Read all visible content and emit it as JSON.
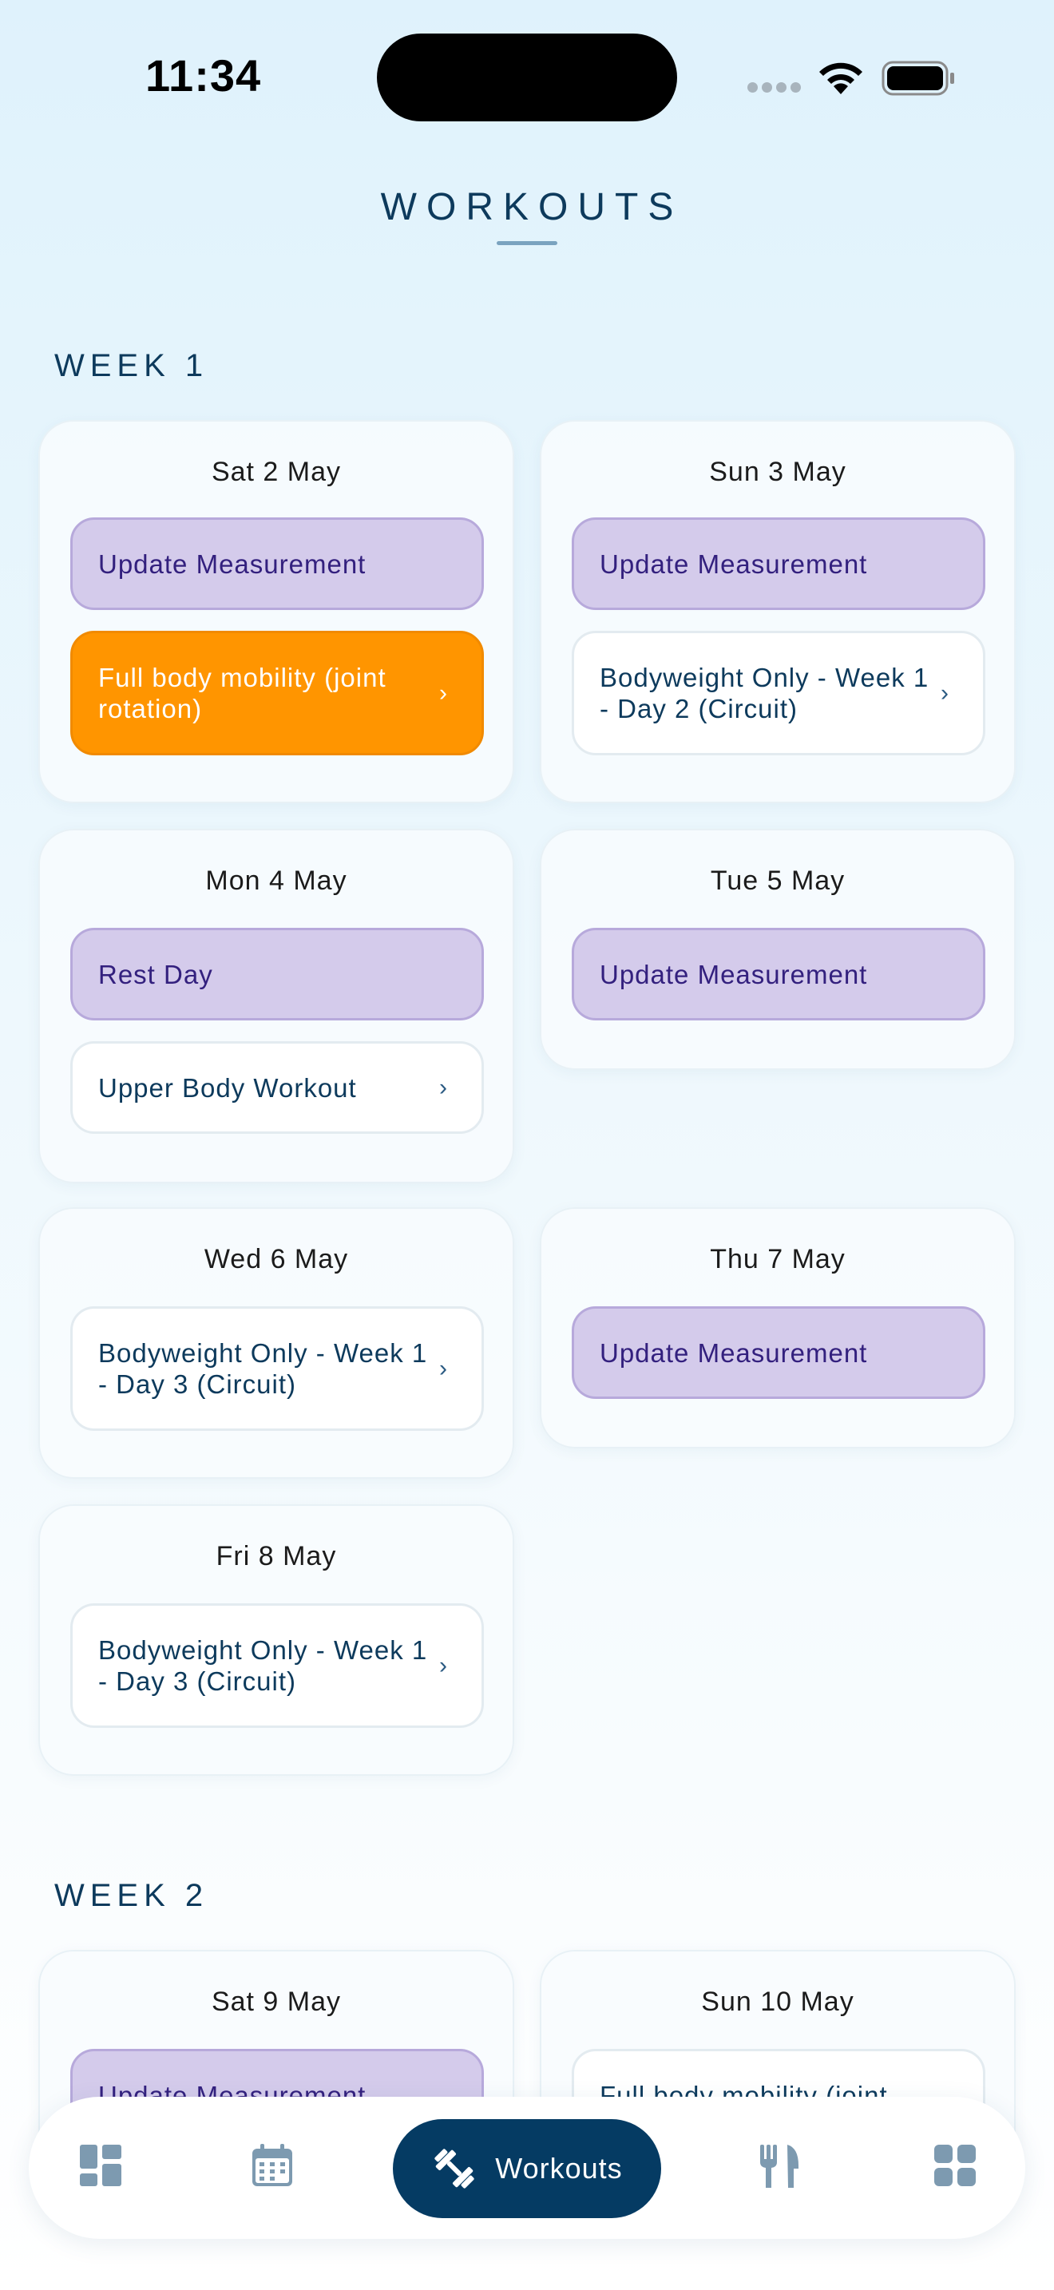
{
  "status_bar": {
    "time": "11:34"
  },
  "header": {
    "title": "WORKOUTS"
  },
  "weeks": [
    {
      "label": "WEEK 1",
      "days": [
        {
          "date": "Sat 2 May",
          "items": [
            {
              "type": "measurement",
              "label": "Update Measurement"
            },
            {
              "type": "workout",
              "label": "Full body mobility (joint rotation)",
              "highlight": true
            }
          ]
        },
        {
          "date": "Sun 3 May",
          "items": [
            {
              "type": "measurement",
              "label": "Update Measurement"
            },
            {
              "type": "workout",
              "label": "Bodyweight Only - Week 1 - Day 2 (Circuit)"
            }
          ]
        },
        {
          "date": "Mon 4 May",
          "items": [
            {
              "type": "measurement",
              "label": "Rest Day"
            },
            {
              "type": "workout",
              "label": "Upper Body Workout"
            }
          ]
        },
        {
          "date": "Tue 5 May",
          "items": [
            {
              "type": "measurement",
              "label": "Update Measurement"
            }
          ]
        },
        {
          "date": "Wed 6 May",
          "items": [
            {
              "type": "workout",
              "label": "Bodyweight Only - Week 1 - Day 3 (Circuit)"
            }
          ]
        },
        {
          "date": "Thu 7 May",
          "items": [
            {
              "type": "measurement",
              "label": "Update Measurement"
            }
          ]
        },
        {
          "date": "Fri 8 May",
          "items": [
            {
              "type": "workout",
              "label": "Bodyweight Only - Week 1 - Day 3 (Circuit)"
            }
          ]
        }
      ]
    },
    {
      "label": "WEEK 2",
      "days": [
        {
          "date": "Sat 9 May",
          "items": [
            {
              "type": "measurement",
              "label": "Update Measurement"
            }
          ]
        },
        {
          "date": "Sun 10 May",
          "items": [
            {
              "type": "workout",
              "label": "Full body mobility (joint"
            }
          ]
        }
      ]
    }
  ],
  "chevron_glyph": "›",
  "tab_bar": {
    "active_label": "Workouts",
    "tabs": [
      "dashboard-icon",
      "calendar-icon",
      "workouts-icon",
      "nutrition-icon",
      "more-icon"
    ]
  },
  "colors": {
    "primary": "#053b63",
    "measurement_bg": "#d4cbeb",
    "highlight_orange": "#ff9500"
  }
}
